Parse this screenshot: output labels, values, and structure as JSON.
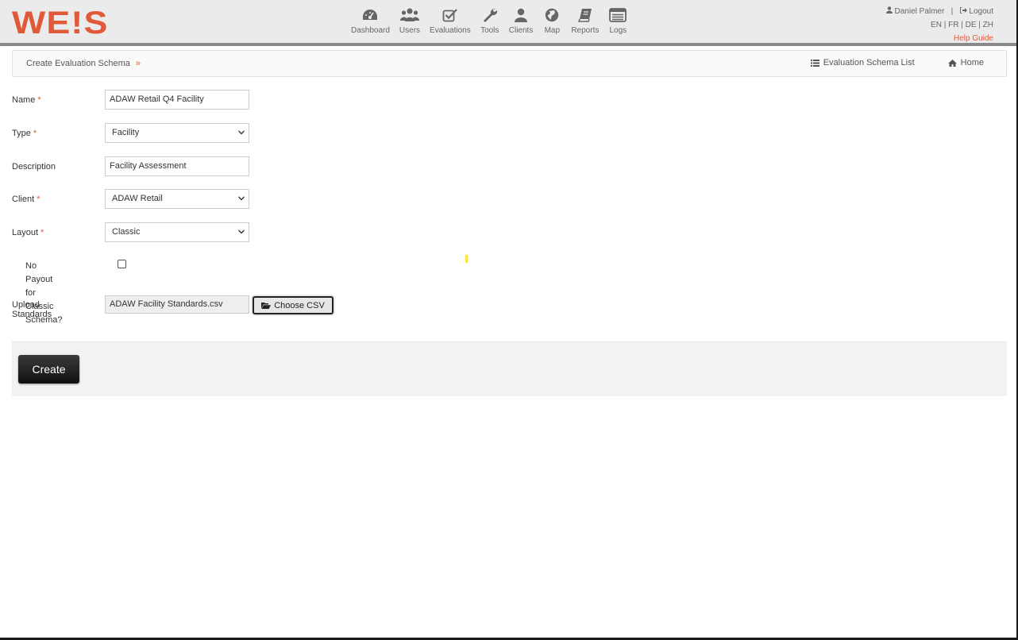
{
  "logo": {
    "parts": [
      {
        "text": "WE",
        "color": "#e05a3a"
      },
      {
        "text": "!",
        "color": "#e05a3a"
      },
      {
        "text": "S",
        "color": "#e05a3a"
      }
    ]
  },
  "nav": [
    {
      "label": "Dashboard",
      "icon": "dashboard-icon"
    },
    {
      "label": "Users",
      "icon": "users-icon"
    },
    {
      "label": "Evaluations",
      "icon": "checkbox-icon"
    },
    {
      "label": "Tools",
      "icon": "wrench-icon"
    },
    {
      "label": "Clients",
      "icon": "user-icon"
    },
    {
      "label": "Map",
      "icon": "globe-icon"
    },
    {
      "label": "Reports",
      "icon": "book-icon"
    },
    {
      "label": "Logs",
      "icon": "list-window-icon"
    }
  ],
  "user": {
    "name": "Daniel Palmer",
    "separator": "|",
    "logout": "Logout",
    "languages": [
      "EN",
      "FR",
      "DE",
      "ZH"
    ],
    "help": "Help Guide"
  },
  "breadcrumb": {
    "current": "Create Evaluation Schema",
    "separator": "»",
    "links": [
      {
        "label": "Evaluation Schema List",
        "icon": "list-icon"
      },
      {
        "label": "Home",
        "icon": "home-icon"
      }
    ]
  },
  "form": {
    "name": {
      "label": "Name",
      "required": "*",
      "value": "ADAW Retail Q4 Facility"
    },
    "type": {
      "label": "Type",
      "required": "*",
      "value": "Facility"
    },
    "description": {
      "label": "Description",
      "value": "Facility Assessment"
    },
    "client": {
      "label": "Client",
      "required": "*",
      "value": "ADAW Retail"
    },
    "layout": {
      "label": "Layout",
      "required": "*",
      "value": "Classic"
    },
    "no_payout": {
      "label_line1": "No Payout for",
      "label_line2": "Classic Schema?",
      "checked": false
    },
    "upload": {
      "label": "Upload Standards",
      "filename": "ADAW Facility Standards.csv",
      "button": "Choose CSV"
    }
  },
  "actions": {
    "create": "Create"
  },
  "colors": {
    "accent": "#e05a3a",
    "header_bg": "#ebebeb",
    "button_dark": "#1e1e1e"
  }
}
